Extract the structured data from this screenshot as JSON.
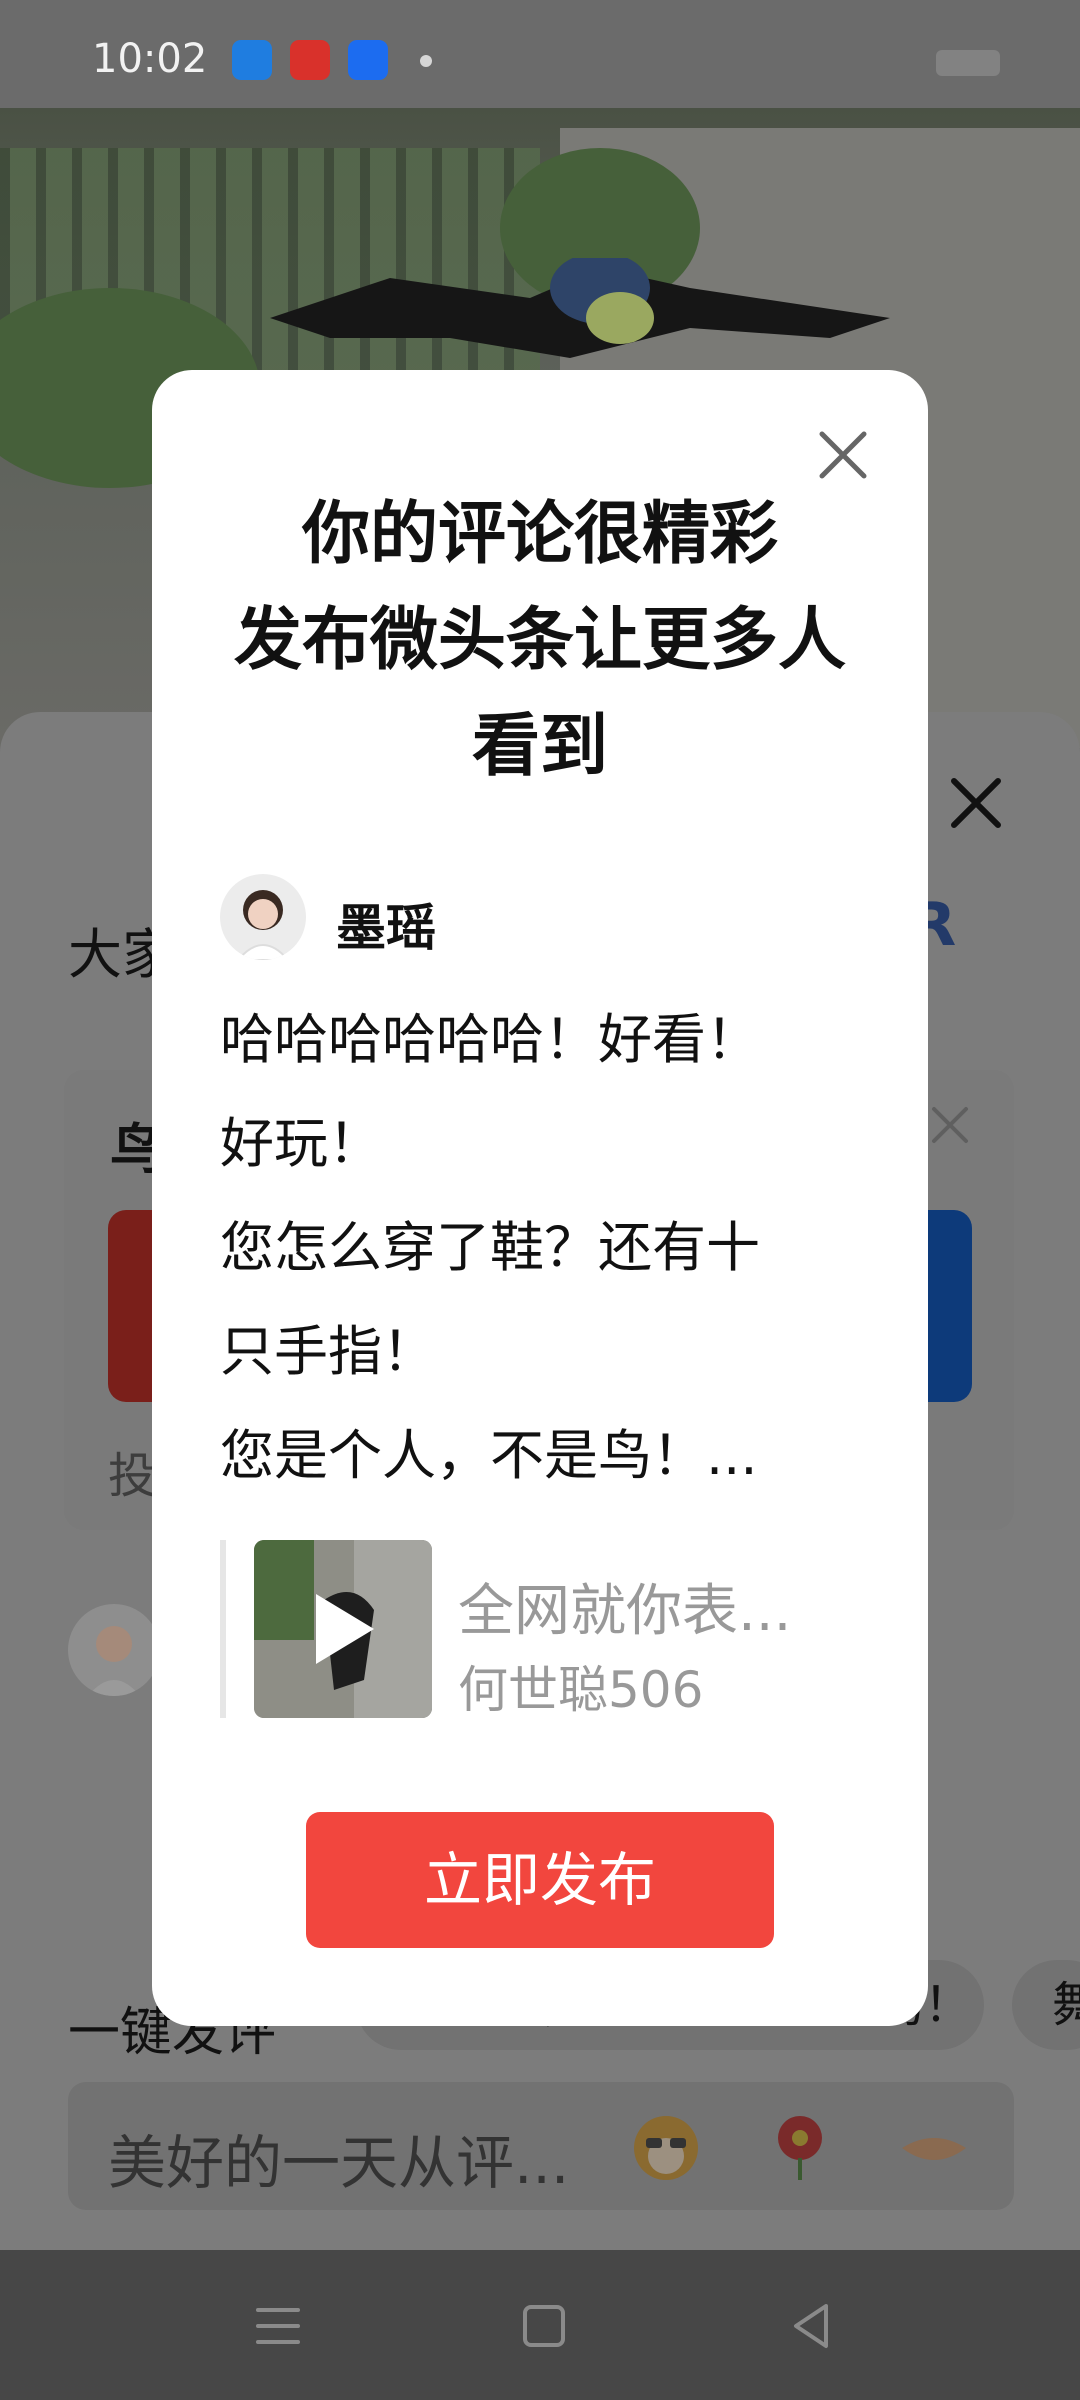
{
  "status_bar": {
    "time": "10:02",
    "app_icons": [
      "browser-app-icon",
      "toutiao-app-icon",
      "files-app-icon"
    ]
  },
  "comment_sheet": {
    "heading": "大家",
    "brand_letter": "R",
    "card_title": "鸟",
    "card_subtitle": "投",
    "chips_label": "一键发评",
    "chips": [
      "太好了，多么有趣的小鸟！",
      "舞"
    ],
    "input_placeholder": "美好的一天从评..."
  },
  "dialog": {
    "title_lines": [
      "你的评论很精彩",
      "发布微头条让更多人",
      "看到"
    ],
    "author_name": "墨瑶",
    "comment_lines": [
      "哈哈哈哈哈哈！好看！",
      "好玩！",
      "您怎么穿了鞋？还有十",
      "只手指！",
      "您是个人，不是鸟！..."
    ],
    "reference": {
      "title": "全网就你表...",
      "author": "何世聪506"
    },
    "publish_label": "立即发布"
  },
  "colors": {
    "accent": "#f2463e",
    "dim_overlay": "#6b6b6b"
  }
}
